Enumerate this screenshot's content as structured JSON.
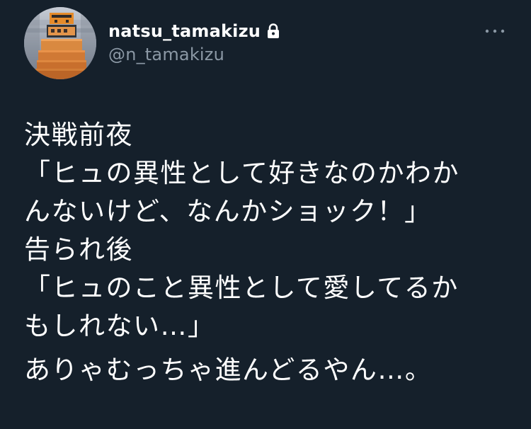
{
  "author": {
    "display_name": "natsu_tamakizu",
    "handle": "@n_tamakizu",
    "protected": true,
    "avatar_icon": "pixel-robot-avatar"
  },
  "tweet": {
    "lines": [
      "決戦前夜",
      "「ヒュの異性として好きなのかわか",
      "んないけど、なんかショック！」",
      "告られ後",
      "「ヒュのこと異性として愛してるか",
      "もしれない…」",
      "ありゃむっちゃ進んどるやん…。"
    ]
  },
  "icons": {
    "lock": "lock-icon",
    "more": "more-horizontal-icon"
  },
  "colors": {
    "background": "#15202b",
    "primary_text": "#ffffff",
    "secondary_text": "#8b98a5"
  }
}
